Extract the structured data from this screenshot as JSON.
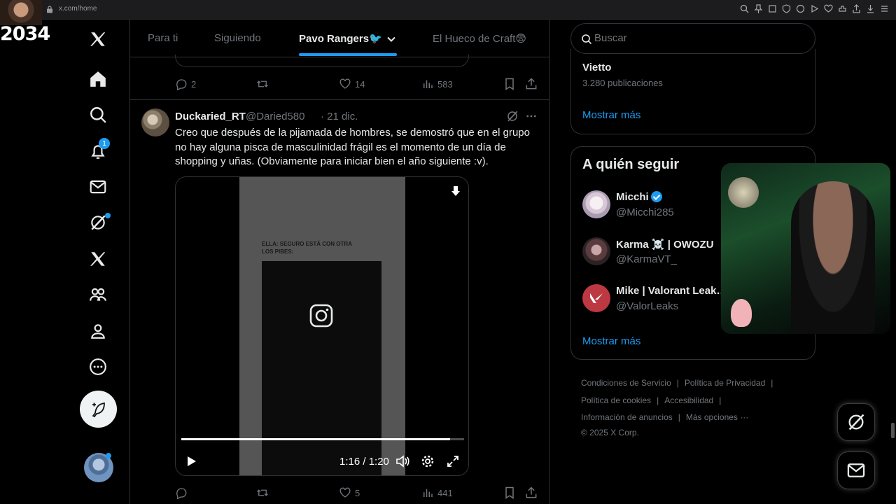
{
  "browser": {
    "url": "x.com/home"
  },
  "overlay": {
    "streamer_number": "2034"
  },
  "nav": {
    "notifications_count": "1"
  },
  "tabs": [
    {
      "label": "Para ti"
    },
    {
      "label": "Siguiendo"
    },
    {
      "label": "Pavo Rangers🐦"
    },
    {
      "label": "El Hueco de Craft😨"
    }
  ],
  "prev_post": {
    "replies": "2",
    "retweets": "",
    "likes": "14",
    "views": "583"
  },
  "post": {
    "name": "Duckaried_RT",
    "handle": "@Daried580",
    "date": "· 21 dic.",
    "text": "Creo que después de la pijamada de hombres, se demostró que en el grupo no hay alguna pisca de masculinidad frágil es el momento de un día de shopping y uñas. (Obviamente para iniciar bien el año siguiente :v).",
    "video": {
      "caption": "ELLA: SEGURO ESTÁ CON OTRA\nLOS PIBES:",
      "time": "1:16 / 1:20",
      "progress": 0.95
    },
    "replies": "",
    "retweets": "",
    "likes": "5",
    "views": "441"
  },
  "search": {
    "placeholder": "Buscar"
  },
  "trend": {
    "name": "Vietto",
    "count": "3.280 publicaciones",
    "show_more": "Mostrar más"
  },
  "who_to_follow": {
    "title": "A quién seguir",
    "users": [
      {
        "name": "Micchi",
        "handle": "@Micchi285",
        "verified": true
      },
      {
        "name": "Karma ☠️ | OWOZU",
        "handle": "@KarmaVT_"
      },
      {
        "name": "Mike | Valorant Leak…",
        "handle": "@ValorLeaks"
      }
    ],
    "show_more": "Mostrar más"
  },
  "footer": {
    "terms": "Condiciones de Servicio",
    "privacy": "Política de Privacidad",
    "cookies": "Política de cookies",
    "accessibility": "Accesibilidad",
    "ads": "Información de anuncios",
    "more": "Más opciones ···",
    "copyright": "© 2025 X Corp."
  },
  "colors": {
    "accent": "#1d9bf0",
    "background": "#000000",
    "border": "#2f3336",
    "muted": "#71767b"
  }
}
